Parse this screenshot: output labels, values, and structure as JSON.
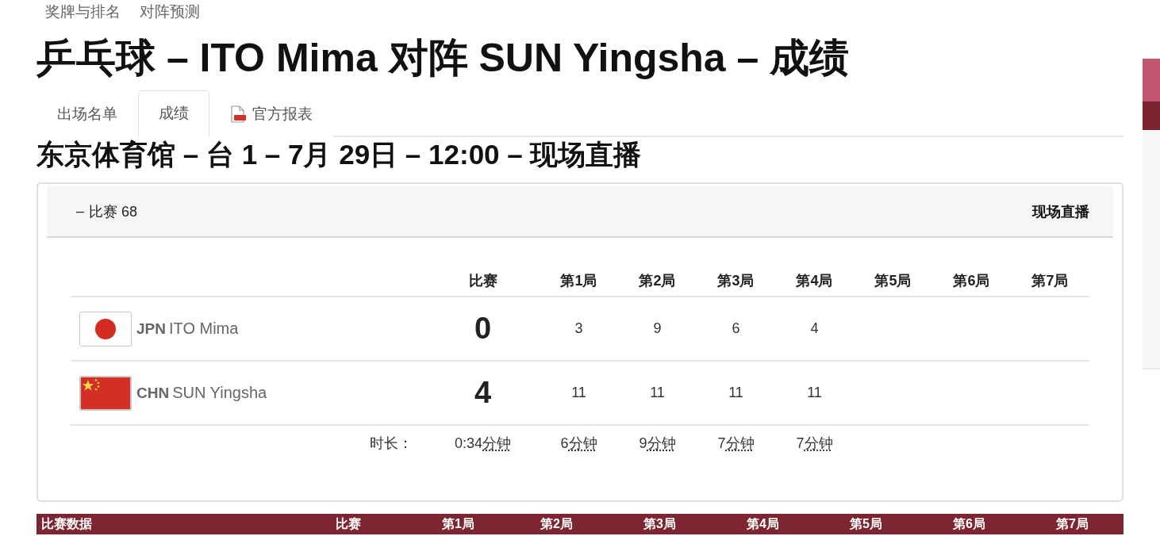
{
  "top_nav": [
    "奖牌与排名",
    "对阵预测"
  ],
  "title": "乒乓球 – ITO Mima 对阵 SUN Yingsha – 成绩",
  "tabs": [
    {
      "label": "出场名单",
      "selected": false,
      "kind": "plain"
    },
    {
      "label": "成绩",
      "selected": true,
      "kind": "plain"
    },
    {
      "label": "官方报表",
      "selected": false,
      "kind": "pdf"
    }
  ],
  "subtitle": "东京体育馆 – 台 1 – 7月 29日 – 12:00 – 现场直播",
  "match": {
    "toggle": "–",
    "title": "比赛 68",
    "status": "现场直播",
    "columns": [
      "比赛",
      "第1局",
      "第2局",
      "第3局",
      "第4局",
      "第5局",
      "第6局",
      "第7局"
    ],
    "players": [
      {
        "kind": "jpn",
        "code": "JPN",
        "name": "ITO Mima",
        "score": "0",
        "games": [
          "3",
          "9",
          "6",
          "4"
        ]
      },
      {
        "kind": "chn",
        "code": "CHN",
        "name": "SUN Yingsha",
        "score": "4",
        "games": [
          "11",
          "11",
          "11",
          "11"
        ]
      }
    ],
    "duration": {
      "label": "时长：",
      "values": [
        {
          "value": "0:34",
          "unit": "分钟"
        },
        {
          "value": "6",
          "unit": "分钟"
        },
        {
          "value": "9",
          "unit": "分钟"
        },
        {
          "value": "7",
          "unit": "分钟"
        },
        {
          "value": "7",
          "unit": "分钟"
        }
      ]
    }
  },
  "stats_table": {
    "columns": [
      "比赛数据",
      "比赛",
      "第1局",
      "第2局",
      "第3局",
      "第4局",
      "第5局",
      "第6局",
      "第7局"
    ]
  }
}
